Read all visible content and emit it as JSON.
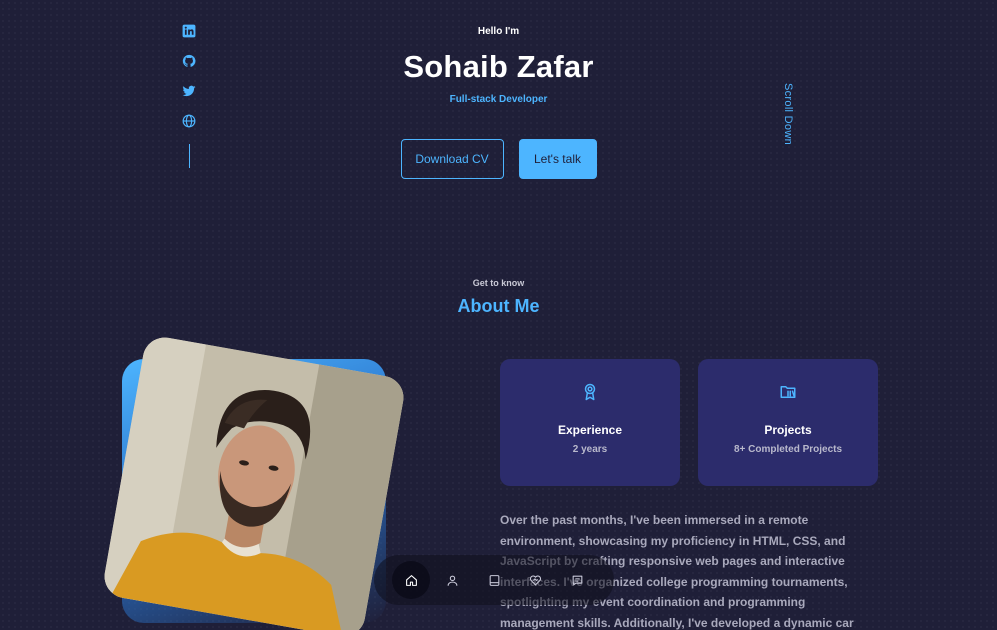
{
  "header": {
    "greeting": "Hello I'm",
    "name": "Sohaib Zafar",
    "role": "Full-stack Developer",
    "download_cv": "Download CV",
    "lets_talk": "Let's talk",
    "scroll_down": "Scroll Down"
  },
  "socials": [
    {
      "icon": "linkedin-icon"
    },
    {
      "icon": "github-icon"
    },
    {
      "icon": "twitter-icon"
    },
    {
      "icon": "globe-icon"
    }
  ],
  "about": {
    "subtitle": "Get to know",
    "title": "About Me",
    "cards": [
      {
        "icon": "award-icon",
        "title": "Experience",
        "value": "2 years"
      },
      {
        "icon": "folder-icon",
        "title": "Projects",
        "value": "8+ Completed Projects"
      }
    ],
    "text": "Over the past months, I've been immersed in a remote environment, showcasing my proficiency in HTML, CSS, and JavaScript by crafting responsive web pages and interactive interfaces. I've organized college programming tournaments, spotlighting my event coordination and programming management skills. Additionally, I've developed a dynamic car insurance website, seamlessly integrating HTML, CSS, JavaScript,"
  },
  "nav": [
    {
      "icon": "home-icon",
      "active": true
    },
    {
      "icon": "user-icon",
      "active": false
    },
    {
      "icon": "book-icon",
      "active": false
    },
    {
      "icon": "service-icon",
      "active": false
    },
    {
      "icon": "message-icon",
      "active": false
    }
  ],
  "colors": {
    "background": "#1f1f38",
    "accent": "#4db5ff",
    "card": "#2c2c6c",
    "text_light": "#a9a9bc"
  }
}
